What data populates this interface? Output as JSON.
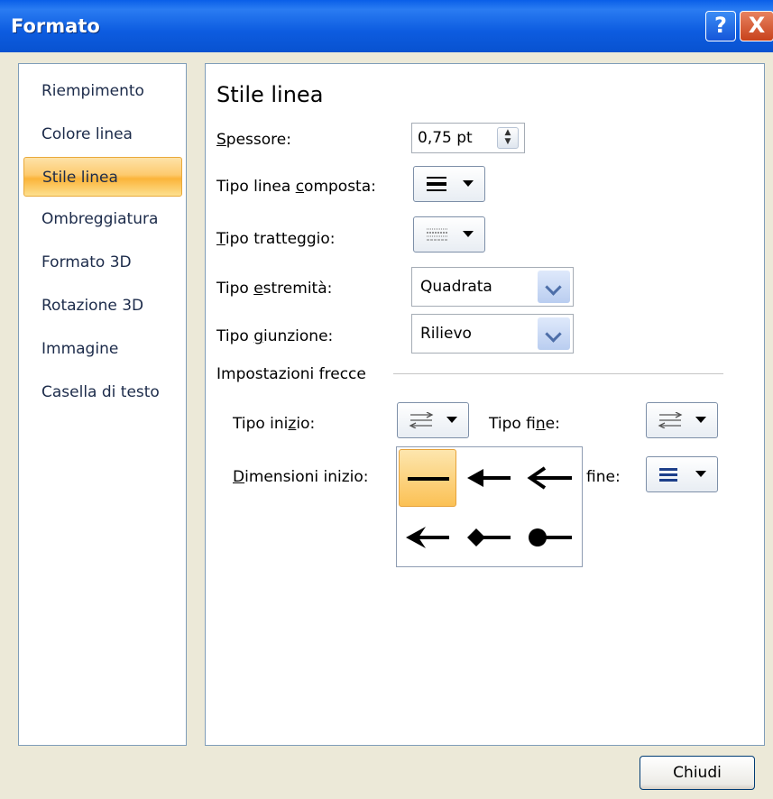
{
  "window": {
    "title": "Formato",
    "help_label": "?",
    "close_label": "X"
  },
  "sidebar": {
    "items": [
      {
        "label": "Riempimento",
        "active": false
      },
      {
        "label": "Colore linea",
        "active": false
      },
      {
        "label": "Stile linea",
        "active": true
      },
      {
        "label": "Ombreggiatura",
        "active": false
      },
      {
        "label": "Formato 3D",
        "active": false
      },
      {
        "label": "Rotazione 3D",
        "active": false
      },
      {
        "label": "Immagine",
        "active": false
      },
      {
        "label": "Casella di testo",
        "active": false
      }
    ]
  },
  "panel": {
    "title": "Stile linea",
    "spessore": {
      "label_u": "S",
      "label_rest": "pessore:",
      "value": "0,75 pt"
    },
    "tipo_linea_composta": {
      "label_a": "Tipo linea ",
      "label_u": "c",
      "label_b": "omposta:"
    },
    "tipo_tratteggio": {
      "label_u": "T",
      "label_rest": "ipo tratteggio:"
    },
    "tipo_estremita": {
      "label_a": "Tipo ",
      "label_u": "e",
      "label_b": "stremità:",
      "value": "Quadrata"
    },
    "tipo_giunzione": {
      "label_a": "Tipo ",
      "label_u": "g",
      "label_b": "iunzione:",
      "value": "Rilievo"
    },
    "frecce": {
      "section_label": "Impostazioni frecce",
      "tipo_inizio": {
        "label_a": "Tipo ini",
        "label_u": "z",
        "label_b": "io:"
      },
      "tipo_fine": {
        "label_a": "Tipo fi",
        "label_u": "n",
        "label_b": "e:"
      },
      "dimensioni_inizio": {
        "label_u": "D",
        "label_rest": "imensioni inizio:"
      },
      "dimensioni_fine_visible": "fine:"
    },
    "arrow_gallery": [
      "none",
      "arrow",
      "open-arrow",
      "stealth-arrow",
      "diamond-arrow",
      "oval-arrow"
    ]
  },
  "footer": {
    "close_button": "Chiudi"
  }
}
